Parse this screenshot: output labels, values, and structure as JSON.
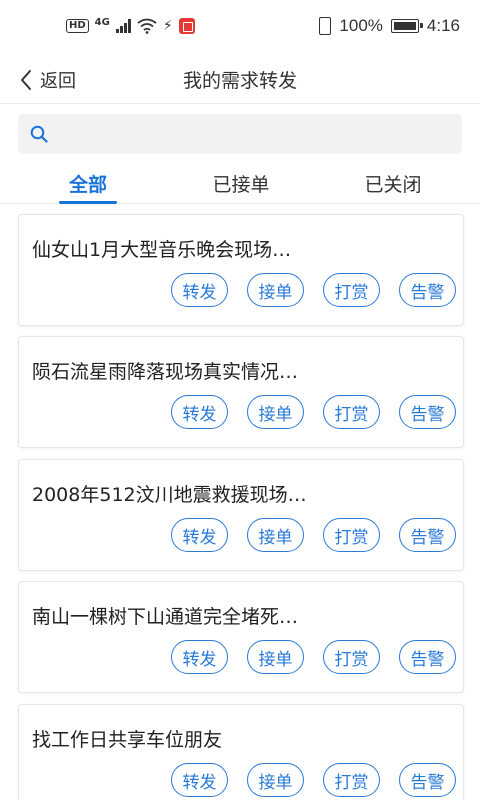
{
  "status_bar": {
    "left_icons": [
      "hd-icon",
      "4g-signal-icon",
      "wifi-icon",
      "usb-icon",
      "app-notification-icon"
    ],
    "network_label": "4G",
    "hd_label": "HD",
    "battery_percent": "100%",
    "time": "4:16"
  },
  "nav": {
    "back_label": "返回",
    "title": "我的需求转发"
  },
  "search": {
    "placeholder": "",
    "value": ""
  },
  "tabs": [
    {
      "label": "全部",
      "active": true
    },
    {
      "label": "已接单",
      "active": false
    },
    {
      "label": "已关闭",
      "active": false
    }
  ],
  "actions": {
    "forward": "转发",
    "accept": "接单",
    "reward": "打赏",
    "report": "告警"
  },
  "items": [
    {
      "title": "仙女山1月大型音乐晚会现场…"
    },
    {
      "title": "陨石流星雨降落现场真实情况…"
    },
    {
      "title": "2008年512汶川地震救援现场…"
    },
    {
      "title": "南山一棵树下山通道完全堵死…"
    },
    {
      "title": "找工作日共享车位朋友"
    }
  ],
  "colors": {
    "accent": "#1a73d9",
    "pill_border": "#2a7ad8"
  }
}
